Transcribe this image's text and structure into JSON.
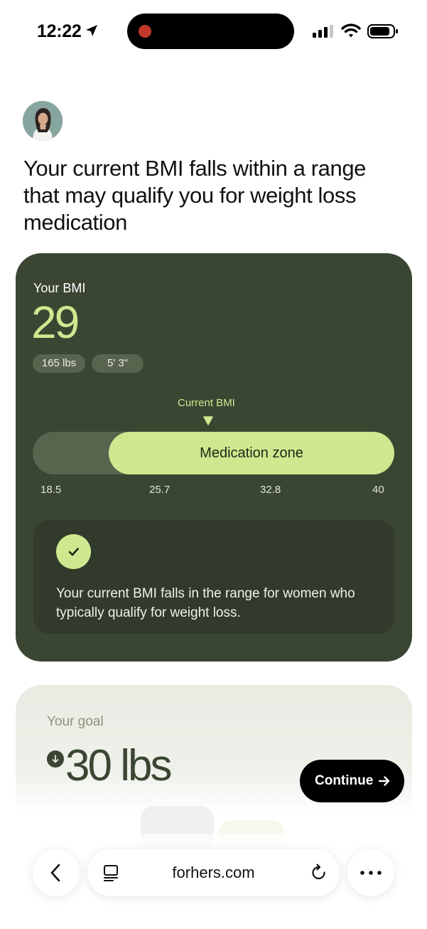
{
  "status_bar": {
    "time": "12:22"
  },
  "header": {
    "avatar_icon": "doctor-avatar",
    "headline": "Your current BMI falls within a range that may qualify you for weight loss medication"
  },
  "bmi_card": {
    "label": "Your BMI",
    "value": "29",
    "weight_chip": "165 lbs",
    "height_chip": "5' 3\"",
    "current_label": "Current BMI",
    "zone_label": "Medication zone",
    "ticks": [
      "18.5",
      "25.7",
      "32.8",
      "40"
    ],
    "info_text": "Your current BMI falls in the range for women who typically qualify for weight loss.",
    "accent_color": "#cde88f",
    "card_color": "#3a4632"
  },
  "goal_card": {
    "label": "Your goal",
    "value": "30 lbs",
    "arrow_icon": "arrow-down-icon"
  },
  "continue_button": {
    "label": "Continue",
    "icon": "arrow-right-icon"
  },
  "browser": {
    "url": "forhers.com",
    "back_icon": "chevron-left-icon",
    "reader_icon": "reader-icon",
    "reload_icon": "reload-icon",
    "more_icon": "more-icon"
  }
}
